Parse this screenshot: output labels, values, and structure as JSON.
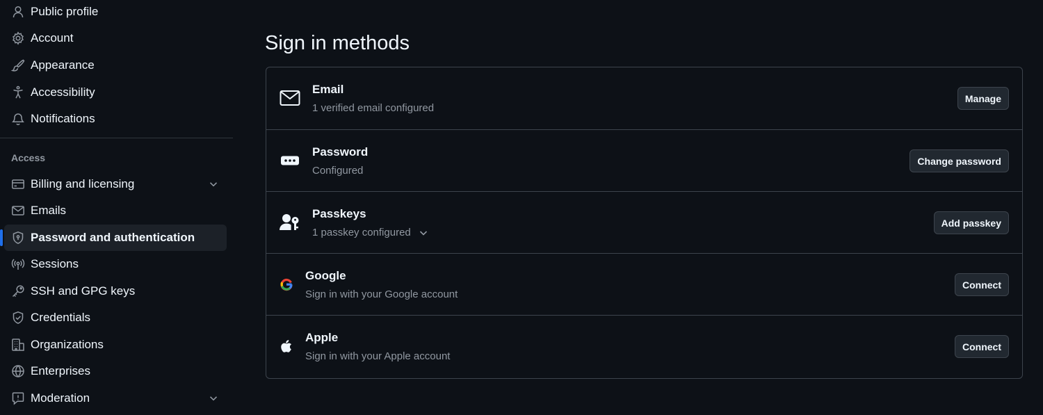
{
  "sidebar": {
    "items_top": [
      {
        "label": "Public profile",
        "icon": "person-icon"
      },
      {
        "label": "Account",
        "icon": "gear-icon"
      },
      {
        "label": "Appearance",
        "icon": "paintbrush-icon"
      },
      {
        "label": "Accessibility",
        "icon": "accessibility-icon"
      },
      {
        "label": "Notifications",
        "icon": "bell-icon"
      }
    ],
    "access_heading": "Access",
    "items_access": [
      {
        "label": "Billing and licensing",
        "icon": "credit-card-icon",
        "expandable": true
      },
      {
        "label": "Emails",
        "icon": "mail-icon"
      },
      {
        "label": "Password and authentication",
        "icon": "shield-lock-icon",
        "active": true
      },
      {
        "label": "Sessions",
        "icon": "broadcast-icon"
      },
      {
        "label": "SSH and GPG keys",
        "icon": "key-icon"
      },
      {
        "label": "Credentials",
        "icon": "shield-check-icon"
      },
      {
        "label": "Organizations",
        "icon": "organization-icon"
      },
      {
        "label": "Enterprises",
        "icon": "globe-icon"
      },
      {
        "label": "Moderation",
        "icon": "report-icon",
        "expandable": true
      }
    ]
  },
  "main": {
    "title": "Sign in methods",
    "methods": [
      {
        "title": "Email",
        "subtitle": "1 verified email configured",
        "button": "Manage",
        "icon": "mail-icon"
      },
      {
        "title": "Password",
        "subtitle": "Configured",
        "button": "Change password",
        "icon": "password-icon"
      },
      {
        "title": "Passkeys",
        "subtitle": "1 passkey configured",
        "button": "Add passkey",
        "icon": "passkey-icon"
      },
      {
        "title": "Google",
        "subtitle": "Sign in with your Google account",
        "button": "Connect",
        "icon": "google-icon"
      },
      {
        "title": "Apple",
        "subtitle": "Sign in with your Apple account",
        "button": "Connect",
        "icon": "apple-icon"
      }
    ]
  },
  "colors": {
    "background": "#0d1117",
    "text": "#f0f6fc",
    "muted": "#9198a1",
    "border": "#3d444d",
    "accent": "#1f6feb",
    "google_blue": "#4285F4",
    "google_red": "#EA4335",
    "google_yellow": "#FBBC05",
    "google_green": "#34A853"
  }
}
